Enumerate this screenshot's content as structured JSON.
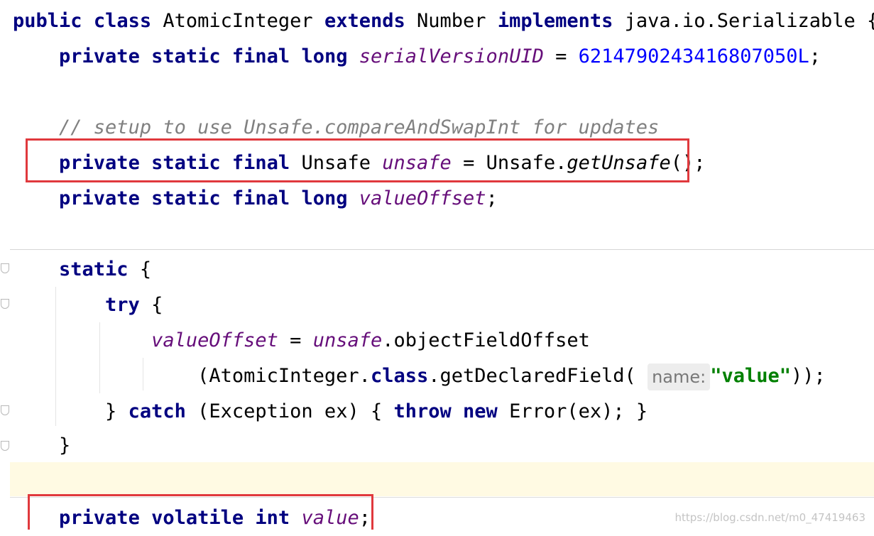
{
  "editor": {
    "code": {
      "l1": {
        "public": "public",
        "class": "class",
        "name": "AtomicInteger",
        "extends": "extends",
        "number": "Number",
        "implements": "implements",
        "iface": "java.io.Serializable",
        "brace": "{"
      },
      "l2": {
        "private": "private",
        "static": "static",
        "final": "final",
        "long": "long",
        "field": "serialVersionUID",
        "eq": "=",
        "value": "6214790243416807050L",
        "semi": ";"
      },
      "l4": {
        "comment": "// setup to use Unsafe.compareAndSwapInt for updates"
      },
      "l5": {
        "private": "private",
        "static": "static",
        "final": "final",
        "type": "Unsafe",
        "field": "unsafe",
        "eq": "=",
        "cls": "Unsafe.",
        "method": "getUnsafe",
        "rest": "();"
      },
      "l6": {
        "private": "private",
        "static": "static",
        "final": "final",
        "long": "long",
        "field": "valueOffset",
        "semi": ";"
      },
      "l8": {
        "static": "static",
        "brace": "{"
      },
      "l9": {
        "try": "try",
        "brace": "{"
      },
      "l10": {
        "field": "valueOffset",
        "eq": "=",
        "field2": "unsafe",
        "rest": ".objectFieldOffset"
      },
      "l11": {
        "pre": "(AtomicInteger.",
        "class": "class",
        "mid": ".getDeclaredField(",
        "hint": "name:",
        "str": "\"value\"",
        "rest": "));"
      },
      "l12": {
        "close": "}",
        "catch": "catch",
        "mid": "(Exception ex) {",
        "throw": "throw",
        "new": "new",
        "rest": "Error(ex); }"
      },
      "l13": {
        "close": "}"
      },
      "l15": {
        "private": "private",
        "volatile": "volatile",
        "int": "int",
        "field": "value",
        "semi": ";"
      }
    },
    "watermark": "https://blog.csdn.net/m0_47419463",
    "highlight_color": "#e0393d"
  }
}
